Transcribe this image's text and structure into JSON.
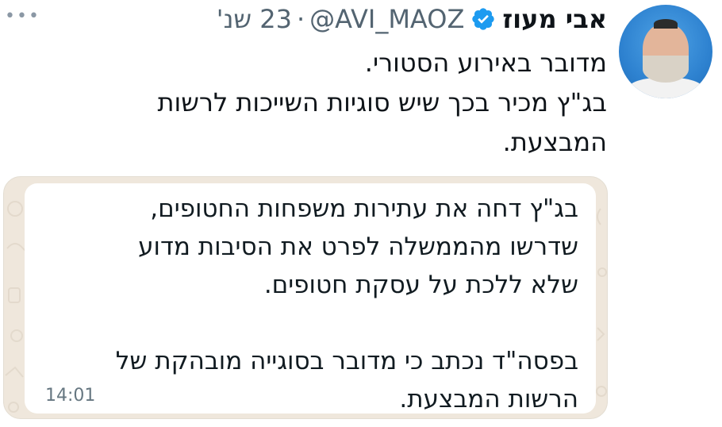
{
  "tweet": {
    "author_name": "אבי מעוז",
    "handle": "@AVI_MAOZ",
    "separator": "·",
    "time": "23 שנ'",
    "text_lines": [
      "מדובר באירוע הסטורי.",
      "בג\"ץ מכיר בכך שיש סוגיות השייכות לרשות",
      "המבצעת."
    ]
  },
  "media": {
    "message_paragraph1": [
      "בג\"ץ דחה את עתירות משפחות החטופים,",
      "שדרשו מהממשלה לפרט את הסיבות מדוע",
      "שלא ללכת על עסקת חטופים."
    ],
    "message_paragraph2": [
      "בפסה\"ד נכתב כי מדובר בסוגייה מובהקת של",
      "הרשות המבצעת."
    ],
    "message_time": "14:01"
  },
  "icons": {
    "verified": "verified-badge-icon",
    "more": "more-options-icon"
  },
  "colors": {
    "verified_blue": "#1d9bf0",
    "chat_background": "#efe7dc",
    "secondary_text": "#536471"
  }
}
